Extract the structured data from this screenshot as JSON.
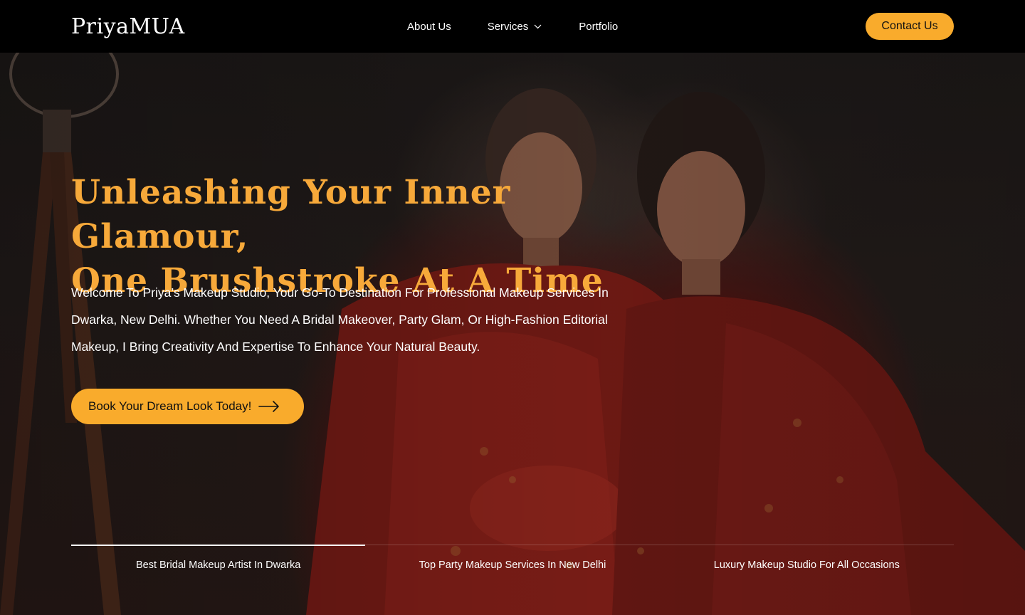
{
  "brand": {
    "name": "PriyaMUA"
  },
  "nav": {
    "items": [
      {
        "label": "About Us"
      },
      {
        "label": "Services",
        "icon": "chevron-down-icon"
      },
      {
        "label": "Portfolio"
      }
    ],
    "contact_label": "Contact Us"
  },
  "hero": {
    "headline_line1": "Unleashing Your Inner Glamour,",
    "headline_line2": "One Brushstroke At A Time",
    "intro": "Welcome To Priya’s Makeup Studio, Your Go-To Destination For Professional Makeup Services In Dwarka, New Delhi. Whether You Need A Bridal Makeover, Party Glam, Or High-Fashion Editorial Makeup, I Bring Creativity And Expertise To Enhance Your Natural Beauty.",
    "cta_label": "Book Your Dream Look Today!",
    "cta_icon": "arrow-right-icon"
  },
  "tabs": [
    {
      "label": "Best Bridal Makeup Artist In Dwarka",
      "active": true
    },
    {
      "label": "Top Party Makeup Services In New Delhi",
      "active": false
    },
    {
      "label": "Luxury Makeup Studio For All Occasions",
      "active": false
    }
  ],
  "colors": {
    "accent": "#f9ab2c",
    "headline": "#f7a93a",
    "header_bg": "#000000",
    "bridal_red": "#7a1a15"
  }
}
